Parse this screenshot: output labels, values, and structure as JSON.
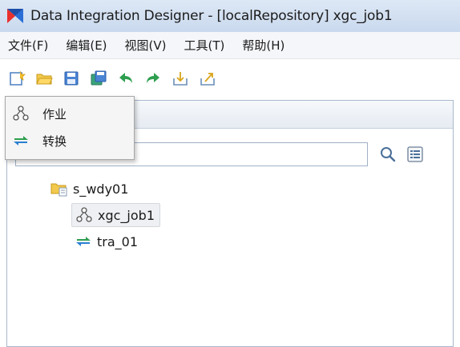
{
  "window": {
    "title": "Data Integration Designer - [localRepository] xgc_job1",
    "logo_icon": "kettle-logo-icon"
  },
  "menubar": {
    "items": [
      {
        "label": "文件(F)"
      },
      {
        "label": "编辑(E)"
      },
      {
        "label": "视图(V)"
      },
      {
        "label": "工具(T)"
      },
      {
        "label": "帮助(H)"
      }
    ]
  },
  "toolbar": {
    "buttons": [
      {
        "icon": "new-file-icon"
      },
      {
        "icon": "open-folder-icon"
      },
      {
        "icon": "save-icon"
      },
      {
        "icon": "save-as-icon"
      },
      {
        "icon": "undo-arrow-icon"
      },
      {
        "icon": "redo-arrow-icon"
      },
      {
        "icon": "import-icon"
      },
      {
        "icon": "export-icon"
      }
    ]
  },
  "new_menu": {
    "items": [
      {
        "label": "作业",
        "icon": "job-icon"
      },
      {
        "label": "转换",
        "icon": "transformation-icon"
      }
    ]
  },
  "search": {
    "value": "",
    "placeholder": ""
  },
  "tree": {
    "items": [
      {
        "label": "s_wdy01",
        "icon": "folder-icon",
        "level": 0
      },
      {
        "label": "xgc_job1",
        "icon": "job-icon",
        "level": 1,
        "selected": true
      },
      {
        "label": "tra_01",
        "icon": "transformation-icon",
        "level": 1
      }
    ]
  }
}
